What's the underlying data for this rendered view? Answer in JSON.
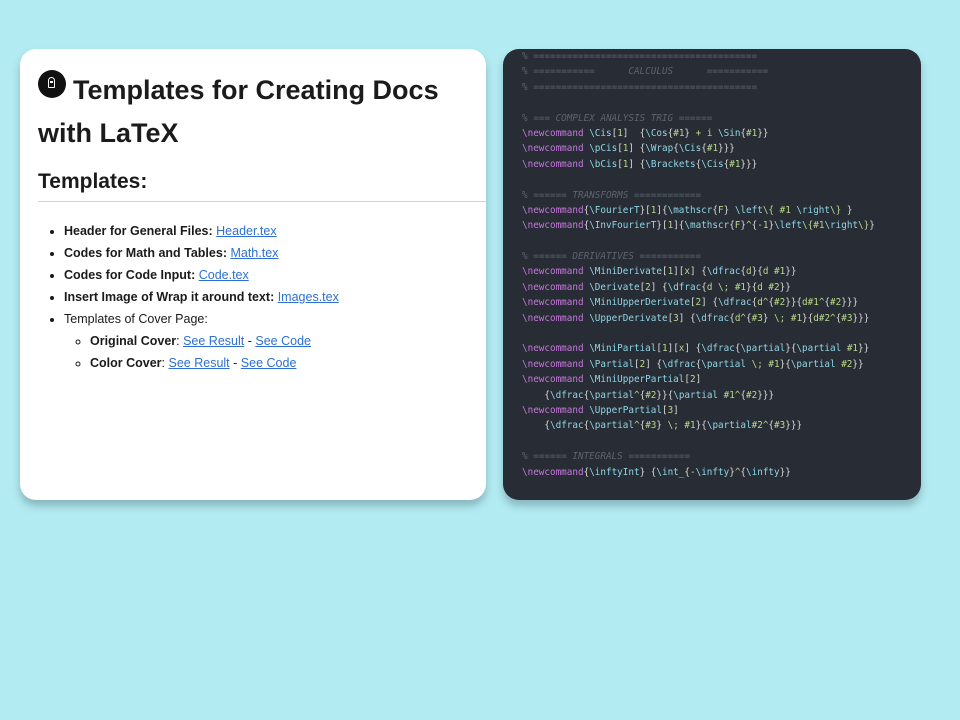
{
  "doc": {
    "title": "Templates for Creating Docs with LaTeX",
    "section_heading": "Templates:",
    "items": [
      {
        "label": "Header for General Files",
        "link": "Header.tex"
      },
      {
        "label": "Codes for Math and Tables",
        "link": "Math.tex"
      },
      {
        "label": "Codes for Code Input",
        "link": "Code.tex"
      },
      {
        "label": "Insert Image of Wrap it around text",
        "link": "Images.tex"
      }
    ],
    "cover_item": "Templates of Cover Page:",
    "covers": [
      {
        "label": "Original Cover",
        "result_link": "See Result",
        "separator": "-",
        "code_link": "See Code"
      },
      {
        "label": "Color Cover",
        "result_link": "See Result",
        "separator": "-",
        "code_link": "See Code"
      }
    ]
  },
  "code": {
    "lines": [
      "% ========================================",
      "% ===========      CALCULUS      ===========",
      "% ========================================",
      "",
      "% === COMPLEX ANALYSIS TRIG ======",
      "\\newcommand \\Cis[1]  {\\Cos{#1} + i \\Sin{#1}}",
      "\\newcommand \\pCis[1] {\\Wrap{\\Cis{#1}}}",
      "\\newcommand \\bCis[1] {\\Brackets{\\Cis{#1}}}",
      "",
      "% ====== TRANSFORMS ============",
      "\\newcommand{\\FourierT}[1]{\\mathscr{F} \\left\\{ #1 \\right\\} }",
      "\\newcommand{\\InvFourierT}[1]{\\mathscr{F}^{-1}\\left\\{#1\\right\\}}",
      "",
      "% ====== DERIVATIVES ===========",
      "\\newcommand \\MiniDerivate[1][x] {\\dfrac{d}{d #1}}",
      "\\newcommand \\Derivate[2] {\\dfrac{d \\; #1}{d #2}}",
      "\\newcommand \\MiniUpperDerivate[2] {\\dfrac{d^{#2}}{d#1^{#2}}}",
      "\\newcommand \\UpperDerivate[3] {\\dfrac{d^{#3} \\; #1}{d#2^{#3}}}",
      "",
      "\\newcommand \\MiniPartial[1][x] {\\dfrac{\\partial}{\\partial #1}}",
      "\\newcommand \\Partial[2] {\\dfrac{\\partial \\; #1}{\\partial #2}}",
      "\\newcommand \\MiniUpperPartial[2]",
      "    {\\dfrac{\\partial^{#2}}{\\partial #1^{#2}}}",
      "\\newcommand \\UpperPartial[3]",
      "    {\\dfrac{\\partial^{#3} \\; #1}{\\partial#2^{#3}}}",
      "",
      "% ====== INTEGRALS ===========",
      "\\newcommand{\\inftyInt} {\\int_{-\\infty}^{\\infty}}"
    ]
  },
  "colors": {
    "background": "#b3ebf2",
    "code_bg": "#282c34",
    "keyword": "#c678dd",
    "command": "#8fd6e6",
    "argument": "#b8d98a",
    "comment": "#5c6370",
    "link": "#2e6fd1"
  },
  "icons": {
    "logo": "padlock-logo-icon"
  }
}
